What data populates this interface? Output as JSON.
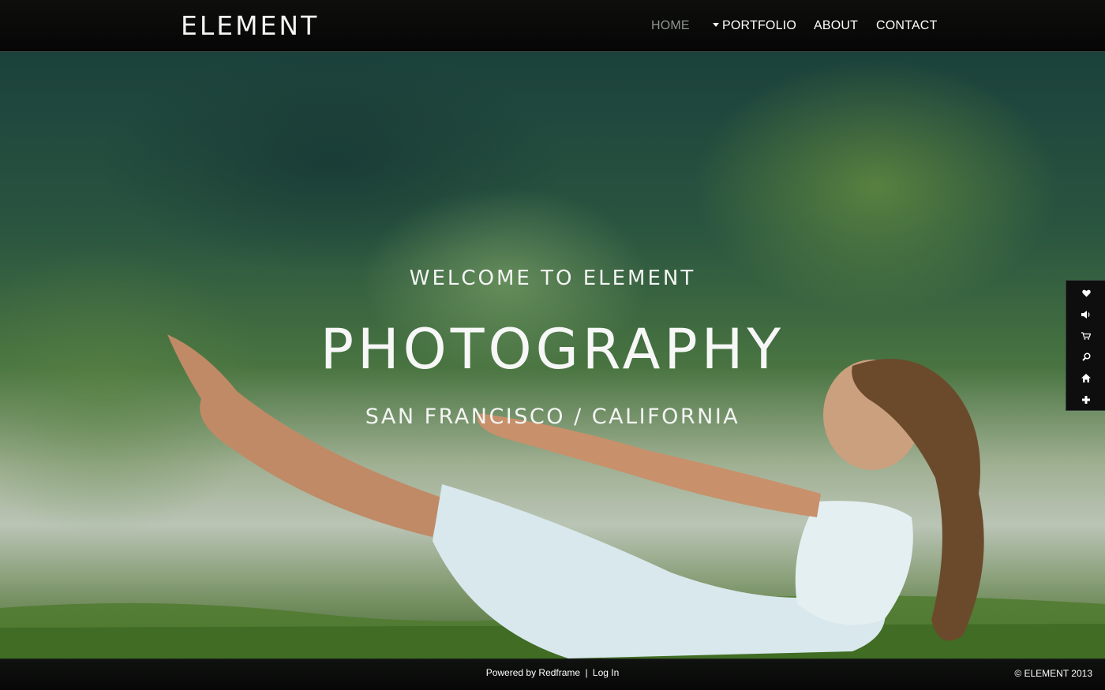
{
  "header": {
    "logo": "ELEMENT",
    "nav": {
      "home": "HOME",
      "portfolio": "PORTFOLIO",
      "about": "ABOUT",
      "contact": "CONTACT"
    },
    "active_item": "HOME"
  },
  "hero": {
    "welcome": "WELCOME TO ELEMENT",
    "headline": "PHOTOGRAPHY",
    "location": "SAN FRANCISCO / CALIFORNIA"
  },
  "sidebar": {
    "icons": [
      "heart-icon",
      "volume-icon",
      "cart-icon",
      "search-icon",
      "home-icon",
      "plus-icon"
    ]
  },
  "footer": {
    "powered_by": "Powered by Redframe",
    "separator": "|",
    "login": "Log In",
    "copyright": "© ELEMENT 2013"
  },
  "colors": {
    "header_bg": "#070807",
    "nav_active": "#8e9391",
    "nav_text": "#ffffff",
    "hero_text": "#f4f6f4",
    "footer_bg": "#0a0b0a"
  }
}
